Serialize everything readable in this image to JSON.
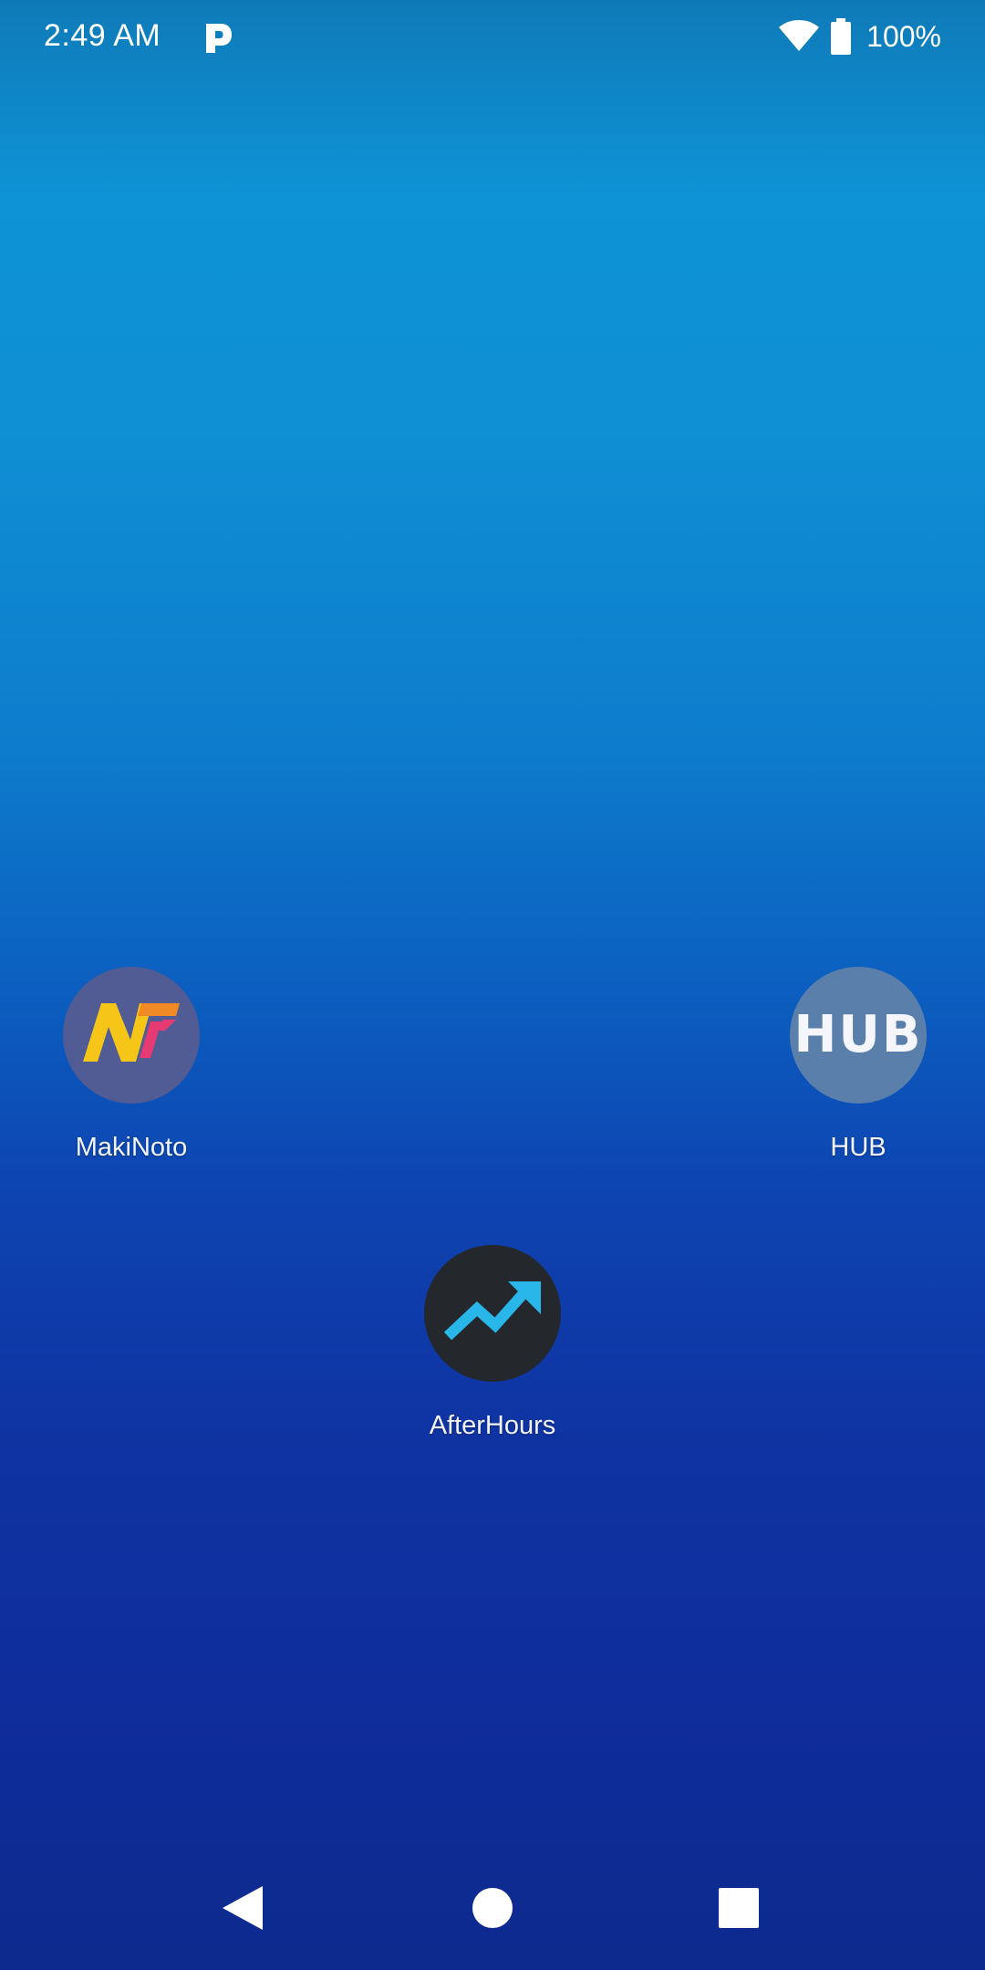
{
  "status_bar": {
    "time": "2:49 AM",
    "notification_icon": "parking-p-icon",
    "wifi_icon": "wifi-icon",
    "battery_icon": "battery-icon",
    "battery_percent": "100%"
  },
  "home": {
    "apps": [
      {
        "label": "MakiNoto",
        "icon": "makinoto-icon"
      },
      {
        "label": "HUB",
        "icon": "hub-icon",
        "icon_text": "HUB"
      },
      {
        "label": "AfterHours",
        "icon": "afterhours-icon"
      }
    ]
  },
  "nav_bar": {
    "back": "back-icon",
    "home": "home-icon",
    "recents": "recents-icon"
  },
  "colors": {
    "wallpaper_top": "#0e93d6",
    "wallpaper_bottom": "#0d2a8e",
    "makinoto_bg": "#515b94",
    "hub_bg": "#5b7fab",
    "afterhours_bg": "#24272c",
    "afterhours_arrow": "#29b6e8"
  }
}
